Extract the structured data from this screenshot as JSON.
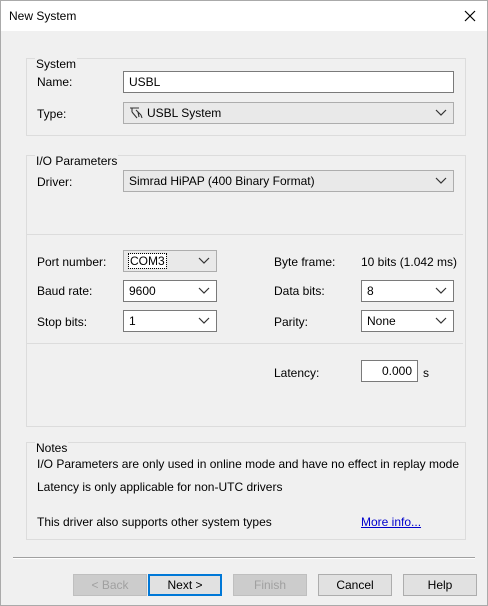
{
  "window": {
    "title": "New System"
  },
  "system": {
    "group_title": "System",
    "name_label": "Name:",
    "name_value": "USBL",
    "type_label": "Type:",
    "type_value": "USBL System"
  },
  "io": {
    "group_title": "I/O Parameters",
    "driver_label": "Driver:",
    "driver_value": "Simrad HiPAP (400 Binary Format)",
    "port_label": "Port number:",
    "port_value": "COM3",
    "baud_label": "Baud rate:",
    "baud_value": "9600",
    "stop_label": "Stop bits:",
    "stop_value": "1",
    "byteframe_label": "Byte frame:",
    "byteframe_value": "10 bits (1.042 ms)",
    "databits_label": "Data bits:",
    "databits_value": "8",
    "parity_label": "Parity:",
    "parity_value": "None",
    "latency_label": "Latency:",
    "latency_value": "0.000",
    "latency_unit": "s"
  },
  "notes": {
    "group_title": "Notes",
    "line1": "I/O Parameters are only used in online mode and have no effect in replay mode",
    "line2": "Latency is only applicable for non-UTC drivers",
    "line3": "This driver also supports other system types",
    "more_link": "More info..."
  },
  "buttons": {
    "back": "< Back",
    "next": "Next >",
    "finish": "Finish",
    "cancel": "Cancel",
    "help": "Help"
  },
  "icons": {
    "type_icon": "usbl-system-icon",
    "close": "close-icon",
    "dropdown": "chevron-down-icon"
  }
}
